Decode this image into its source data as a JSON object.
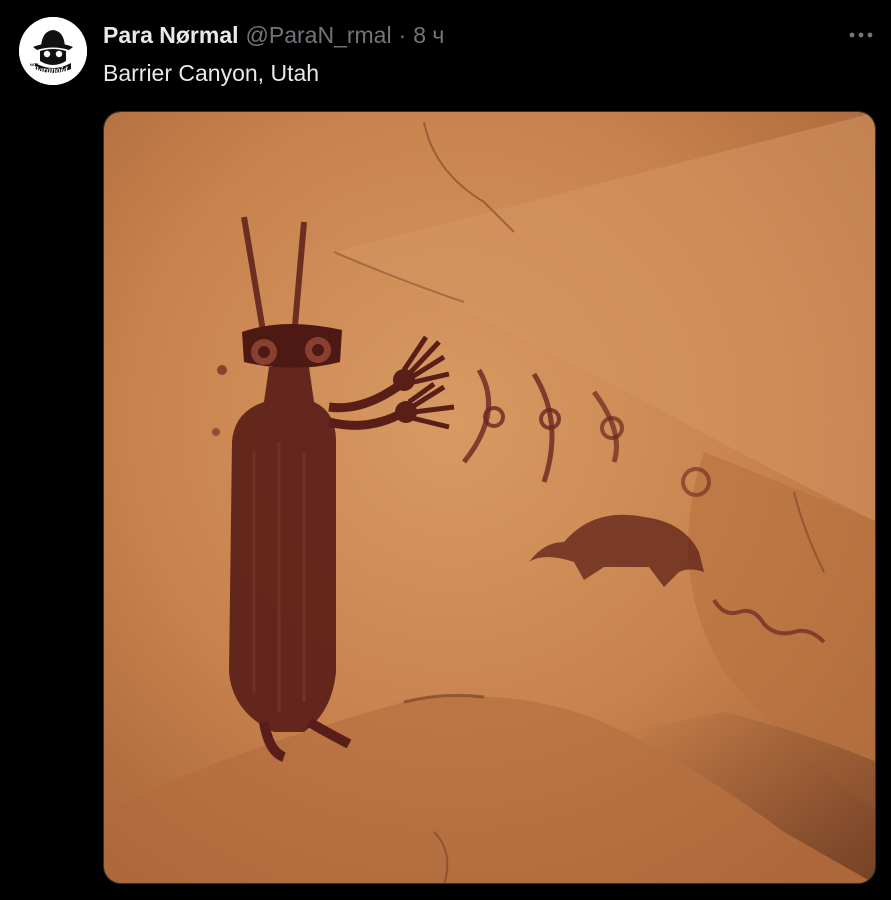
{
  "tweet": {
    "display_name": "Para Nørmal",
    "handle": "@ParaN_rmal",
    "separator": "·",
    "timestamp": "8 ч",
    "text": "Barrier Canyon, Utah",
    "more_icon": "more-dots-icon",
    "avatar": {
      "logo_text_top": "NOT",
      "logo_text": "Paranoid"
    },
    "media": {
      "description_icon": "rock-art-photo"
    }
  },
  "colors": {
    "background": "#000000",
    "primary_text": "#e7e9ea",
    "secondary_text": "#71767b",
    "rock": "#c8824d",
    "pictograph": "#5a1e18"
  }
}
